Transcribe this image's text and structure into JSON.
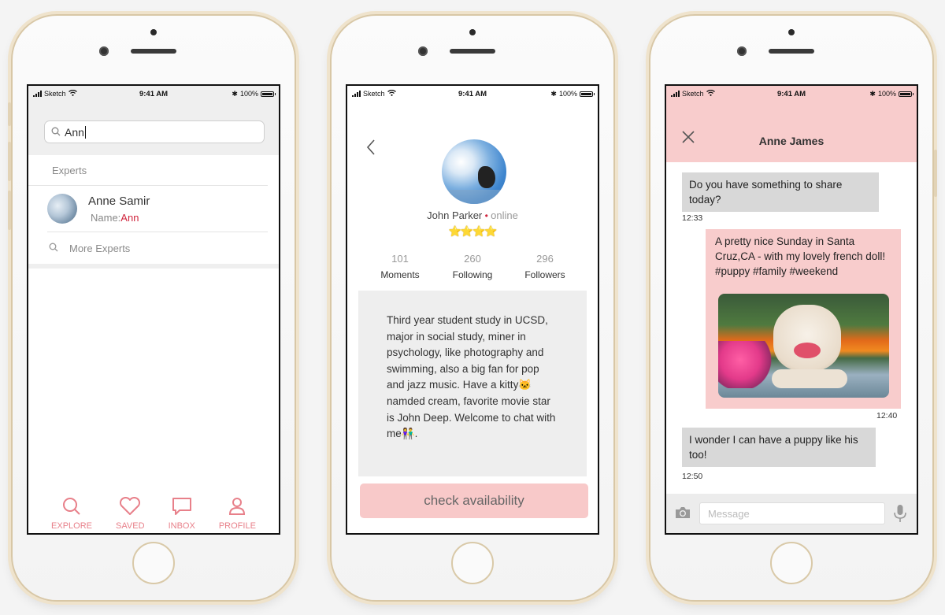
{
  "status_bar": {
    "carrier": "Sketch",
    "time": "9:41 AM",
    "battery": "100%"
  },
  "search_screen": {
    "query": "Ann",
    "section_label": "Experts",
    "result": {
      "name": "Anne Samir",
      "sub_prefix": "Name:",
      "sub_match": "Ann"
    },
    "more_label": "More Experts",
    "tabs": [
      {
        "label": "EXPLORE",
        "icon": "search-icon"
      },
      {
        "label": "SAVED",
        "icon": "heart-icon"
      },
      {
        "label": "INBOX",
        "icon": "chat-bubble-icon"
      },
      {
        "label": "PROFILE",
        "icon": "person-icon"
      }
    ]
  },
  "profile_screen": {
    "name": "John Parker",
    "presence": "online",
    "rating_stars": "⭐⭐⭐⭐",
    "stats": [
      {
        "value": "101",
        "label": "Moments"
      },
      {
        "value": "260",
        "label": "Following"
      },
      {
        "value": "296",
        "label": "Followers"
      }
    ],
    "bio": "Third year student study in  UCSD, major in social study, miner in psychology, like photography and swimming, also a big fan for pop and jazz music. Have a kitty🐱 namded cream, favorite movie star is John Deep. Welcome to chat with me👫.",
    "cta_label": "check availability"
  },
  "chat_screen": {
    "title": "Anne James",
    "messages": [
      {
        "direction": "in",
        "text": "Do you have something to share today?",
        "time": "12:33"
      },
      {
        "direction": "out",
        "text": "A pretty nice Sunday in Santa Cruz,CA - with my lovely french doll! #puppy #family #weekend",
        "time": "12:40"
      },
      {
        "direction": "in",
        "text": "I wonder I can have a puppy like his too!",
        "time": "12:50"
      }
    ],
    "input_placeholder": "Message"
  },
  "colors": {
    "accent_pink": "#f8cccc",
    "tab_pink": "#e8808a",
    "highlight_red": "#d0243c",
    "star_gold": "#f4b400"
  }
}
